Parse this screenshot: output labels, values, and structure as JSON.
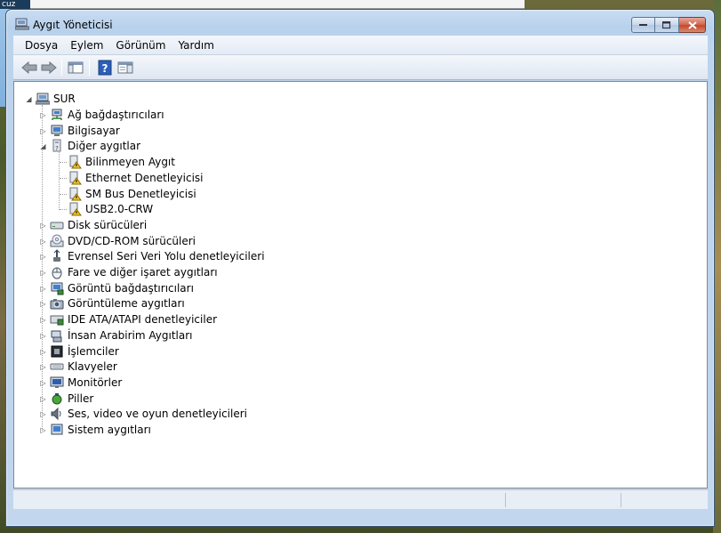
{
  "background": {
    "partial_window_text": "cuz"
  },
  "window": {
    "title": "Aygıt Yöneticisi",
    "controls": {
      "minimize": "▭",
      "maximize": "▢",
      "close": "✕"
    }
  },
  "menu": {
    "items": [
      {
        "label": "Dosya"
      },
      {
        "label": "Eylem"
      },
      {
        "label": "Görünüm"
      },
      {
        "label": "Yardım"
      }
    ]
  },
  "toolbar": {
    "icons": [
      "back-arrow-icon",
      "forward-arrow-icon",
      "console-tree-icon",
      "help-icon",
      "show-hide-action-pane-icon"
    ]
  },
  "tree": {
    "root": {
      "label": "SUR",
      "expanded": true
    },
    "categories": [
      {
        "label": "Ağ bağdaştırıcıları",
        "icon": "network-adapter-icon",
        "expanded": false
      },
      {
        "label": "Bilgisayar",
        "icon": "computer-icon",
        "expanded": false
      },
      {
        "label": "Diğer aygıtlar",
        "icon": "other-devices-icon",
        "expanded": true,
        "children": [
          {
            "label": "Bilinmeyen Aygıt",
            "icon": "warning-device-icon"
          },
          {
            "label": "Ethernet Denetleyicisi",
            "icon": "warning-device-icon"
          },
          {
            "label": "SM Bus Denetleyicisi",
            "icon": "warning-device-icon"
          },
          {
            "label": "USB2.0-CRW",
            "icon": "warning-device-icon"
          }
        ]
      },
      {
        "label": "Disk sürücüleri",
        "icon": "disk-drive-icon",
        "expanded": false
      },
      {
        "label": "DVD/CD-ROM sürücüleri",
        "icon": "dvd-drive-icon",
        "expanded": false
      },
      {
        "label": "Evrensel Seri Veri Yolu denetleyicileri",
        "icon": "usb-controller-icon",
        "expanded": false
      },
      {
        "label": "Fare ve diğer işaret aygıtları",
        "icon": "mouse-icon",
        "expanded": false
      },
      {
        "label": "Görüntü bağdaştırıcıları",
        "icon": "display-adapter-icon",
        "expanded": false
      },
      {
        "label": "Görüntüleme aygıtları",
        "icon": "imaging-device-icon",
        "expanded": false
      },
      {
        "label": "IDE ATA/ATAPI denetleyiciler",
        "icon": "ide-controller-icon",
        "expanded": false
      },
      {
        "label": "İnsan Arabirim Aygıtları",
        "icon": "hid-icon",
        "expanded": false
      },
      {
        "label": "İşlemciler",
        "icon": "processor-icon",
        "expanded": false
      },
      {
        "label": "Klavyeler",
        "icon": "keyboard-icon",
        "expanded": false
      },
      {
        "label": "Monitörler",
        "icon": "monitor-icon",
        "expanded": false
      },
      {
        "label": "Piller",
        "icon": "battery-icon",
        "expanded": false
      },
      {
        "label": "Ses, video ve oyun denetleyicileri",
        "icon": "sound-icon",
        "expanded": false
      },
      {
        "label": "Sistem aygıtları",
        "icon": "system-devices-icon",
        "expanded": false
      }
    ]
  },
  "status": {
    "text": ""
  }
}
